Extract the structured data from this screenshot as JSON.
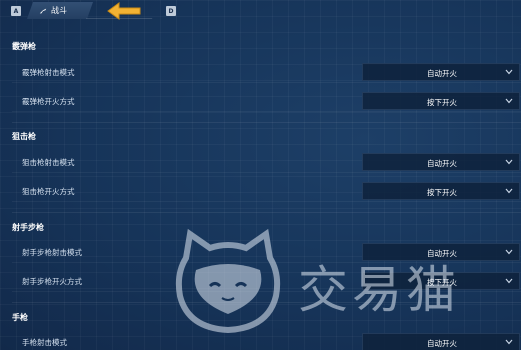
{
  "tabs": {
    "left_key": "A",
    "right_key": "D",
    "active_label": "战斗",
    "inactive_label": ""
  },
  "sections": [
    {
      "title": "霰弹枪",
      "rows": [
        {
          "label": "霰弹枪射击模式",
          "value": "自动开火"
        },
        {
          "label": "霰弹枪开火方式",
          "value": "按下开火"
        }
      ]
    },
    {
      "title": "狙击枪",
      "rows": [
        {
          "label": "狙击枪射击模式",
          "value": "自动开火"
        },
        {
          "label": "狙击枪开火方式",
          "value": "按下开火"
        }
      ]
    },
    {
      "title": "射手步枪",
      "rows": [
        {
          "label": "射手步枪射击模式",
          "value": "自动开火"
        },
        {
          "label": "射手步枪开火方式",
          "value": "按下开火"
        }
      ]
    },
    {
      "title": "手枪",
      "rows": [
        {
          "label": "手枪射击模式",
          "value": "自动开火"
        }
      ]
    }
  ],
  "watermark": {
    "text": "交易猫"
  },
  "colors": {
    "background": "#153256",
    "accent_arrow": "#f2b233"
  }
}
